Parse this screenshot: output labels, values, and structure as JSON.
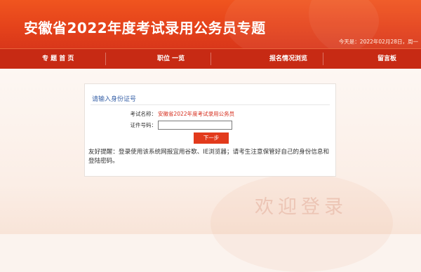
{
  "header": {
    "title": "安徽省2022年度考试录用公务员专题",
    "date_text": "今天是：2022年02月28日，周一"
  },
  "nav": {
    "items": [
      {
        "label": "专 题 首 页"
      },
      {
        "label": "职位 一览"
      },
      {
        "label": "报名情况浏览"
      },
      {
        "label": "留言板"
      }
    ]
  },
  "login": {
    "title": "请输入身份证号",
    "exam_label": "考试名称：",
    "exam_name": "安徽省2022年度考试录用公务员",
    "id_label": "证件号码：",
    "id_value": "",
    "next_button": "下一步",
    "notice": "友好提醒：登录使用该系统网报宜用谷歌、IE浏览器；请考生注意保管好自己的身份信息和登陆密码。"
  },
  "watermark": {
    "text": "欢迎登录"
  },
  "colors": {
    "header_bg": "#e5431b",
    "nav_bg": "#c72a14",
    "accent_red": "#d62d1c",
    "button_bg": "#e23a1c",
    "box_title": "#3a63a8"
  }
}
